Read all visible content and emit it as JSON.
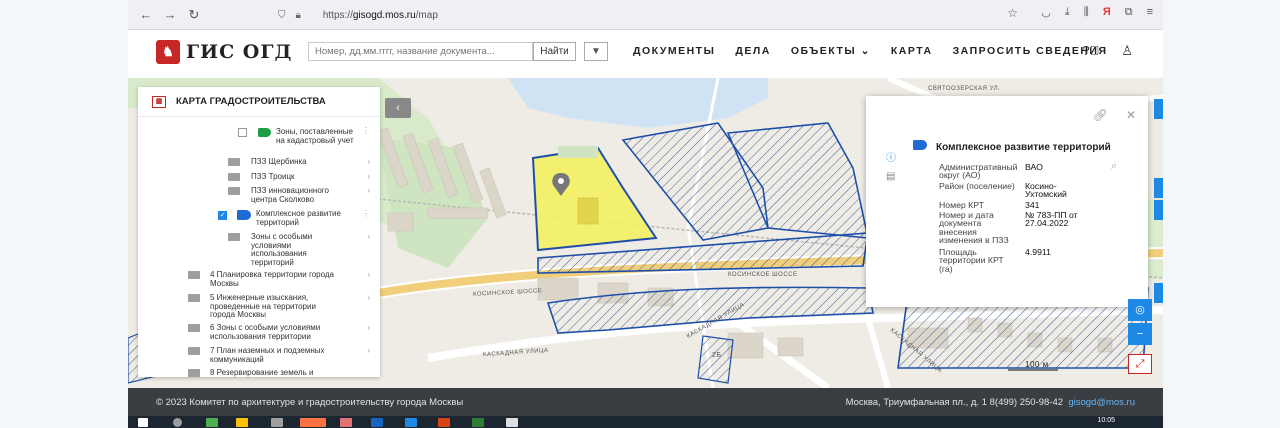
{
  "browser": {
    "url_prefix": "https://",
    "url_domain": "gisogd.mos.ru",
    "url_path": "/map",
    "ext_badge": "Я"
  },
  "header": {
    "logo_text": "ГИС ОГД",
    "search_placeholder": "Номер, дд.мм.гггг, название документа...",
    "search_button": "Найти",
    "nav": [
      "ДОКУМЕНТЫ",
      "ДЕЛА",
      "ОБЪЕКТЫ",
      "КАРТА",
      "ЗАПРОСИТЬ СВЕДЕНИЯ"
    ]
  },
  "layers_panel": {
    "title": "КАРТА ГРАДОСТРОИТЕЛЬСТВА",
    "items": [
      {
        "label": "Зоны, поставленные на кадастровый учет",
        "checked": false
      },
      {
        "label": "ПЗЗ Щербинка"
      },
      {
        "label": "ПЗЗ Троицк"
      },
      {
        "label": "ПЗЗ инновационного центра Сколково"
      },
      {
        "label": "Комплексное развитие территорий",
        "checked": true
      },
      {
        "label": "Зоны с особыми условиями использования территорий"
      },
      {
        "label": "4 Планировка территории города Москвы"
      },
      {
        "label": "5 Инженерные изыскания, проведенные на территории города Москвы"
      },
      {
        "label": "6 Зоны с особыми условиями использования территории"
      },
      {
        "label": "7 План наземных и подземных коммуникаций"
      },
      {
        "label": "8 Резервирование земель и"
      }
    ]
  },
  "info_panel": {
    "title": "Комплексное развитие территорий",
    "rows": [
      {
        "key": "Административный округ (АО)",
        "value": "ВАО"
      },
      {
        "key": "Район (поселение)",
        "value": "Косино-Ухтомский"
      },
      {
        "key": "Номер КРТ",
        "value": "341"
      },
      {
        "key": "Номер и дата документа внесения изменения в ПЗЗ",
        "value": "№ 783-ПП от 27.04.2022"
      },
      {
        "key": "Площадь территории КРТ (га)",
        "value": "4.9911"
      }
    ]
  },
  "map": {
    "labels": {
      "svyatoozerskaya": "СВЯТООЗЕРСКАЯ УЛ.",
      "kosinskoe_1": "КОСИНСКОЕ ШОССЕ",
      "kosinskoe_2": "КОСИНСКОЕ ШОССЕ",
      "kaskadnaya_1": "КАСКАДНАЯ УЛИЦА",
      "kaskadnaya_2": "КАСКАДНАЯ УЛИЦА",
      "kaskadnaya_3": "КАСКАДНАЯ УЛИЦА",
      "house": "2Б"
    },
    "scale": "100 м",
    "colors": {
      "krt_fill": "#f3ef62",
      "krt_border": "#1e4fa8",
      "hatch": "#3d5d9a"
    }
  },
  "footer": {
    "copyright": "© 2023 Комитет по архитектуре и градостроительству города Москвы",
    "address": "Москва, Триумфальная пл., д. 1  8(499) 250-98-42",
    "email": "gisogd@mos.ru"
  },
  "taskbar": {
    "time": "10:05"
  }
}
